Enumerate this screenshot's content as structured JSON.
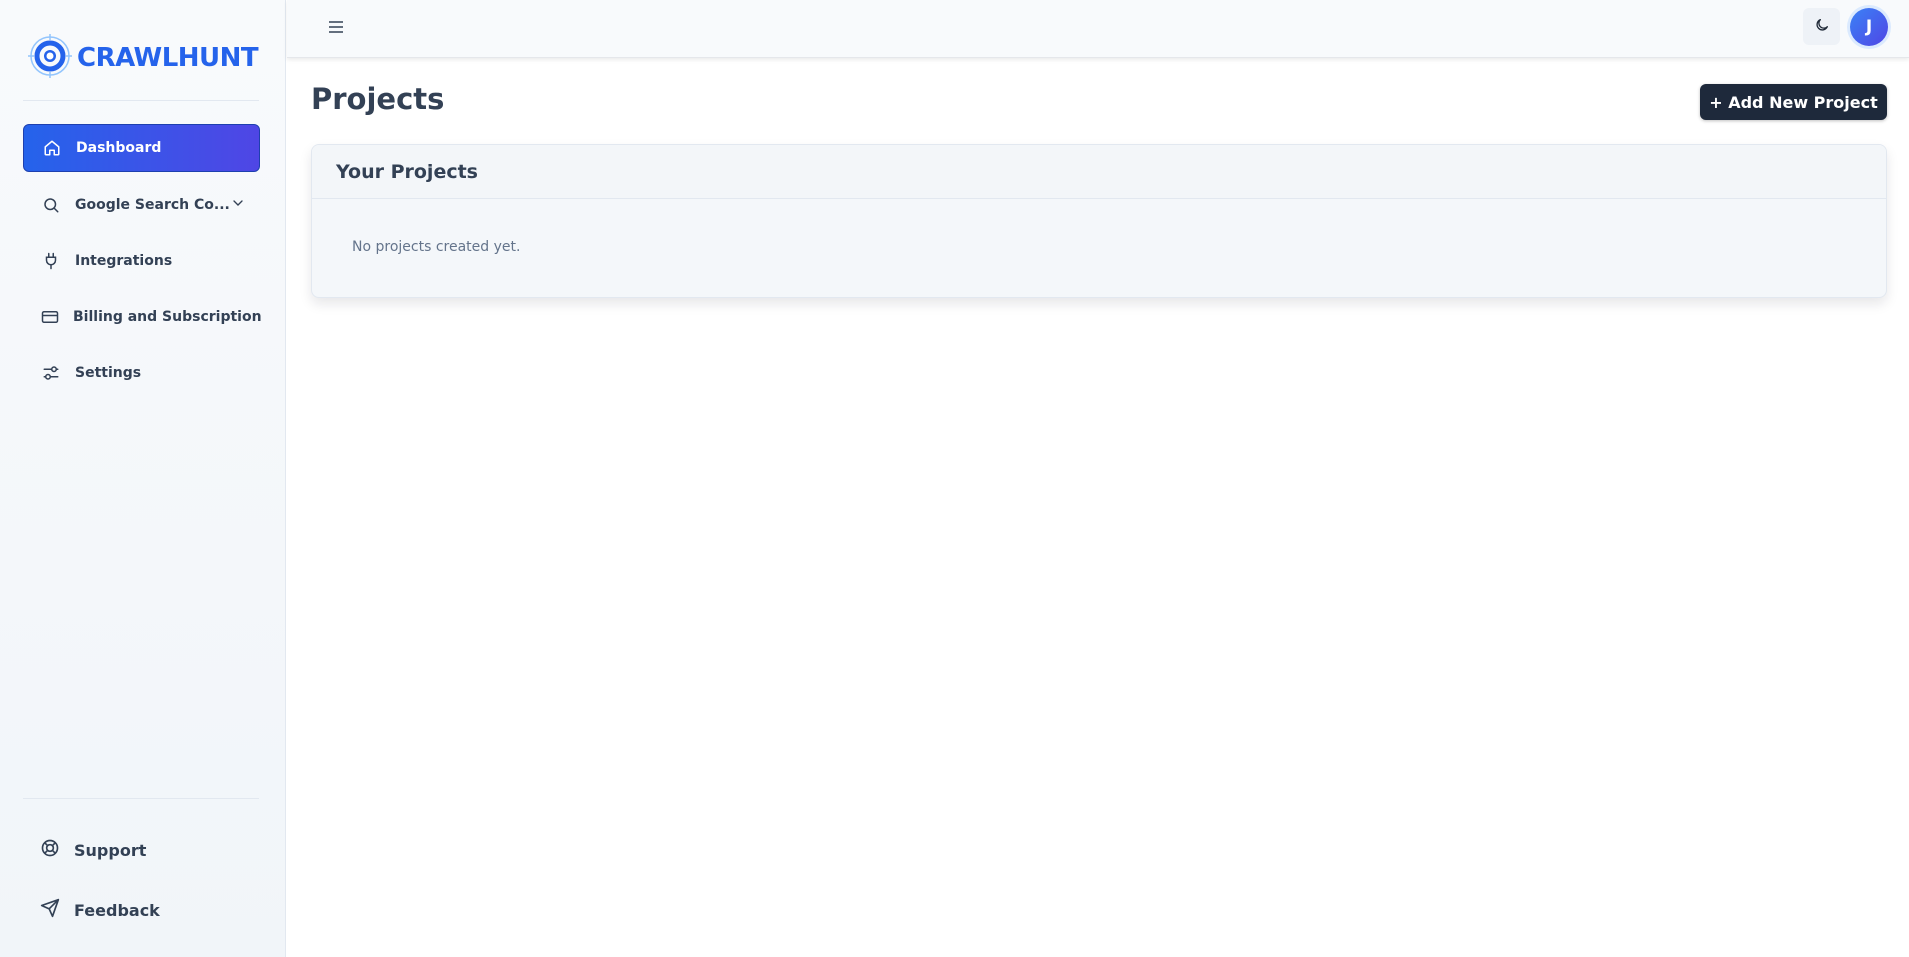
{
  "brand": {
    "name": "CRAWLHUNT",
    "color": "#2563eb"
  },
  "sidebar": {
    "items": [
      {
        "label": "Dashboard",
        "icon": "home-icon",
        "active": true
      },
      {
        "label": "Google Search Co...",
        "icon": "search-icon",
        "expandable": true
      },
      {
        "label": "Integrations",
        "icon": "plug-icon"
      },
      {
        "label": "Billing and Subscription",
        "icon": "credit-card-icon"
      },
      {
        "label": "Settings",
        "icon": "sliders-icon"
      }
    ],
    "bottom": [
      {
        "label": "Support",
        "icon": "lifebuoy-icon"
      },
      {
        "label": "Feedback",
        "icon": "send-icon"
      }
    ]
  },
  "topbar": {
    "avatar_initial": "J",
    "theme_icon": "moon-icon",
    "menu_icon": "hamburger-icon"
  },
  "main": {
    "title": "Projects",
    "add_button": "+ Add New Project",
    "card": {
      "title": "Your Projects",
      "empty_text": "No projects created yet."
    }
  },
  "colors": {
    "accent": "#2563eb",
    "accent_end": "#4f46e5",
    "button_dark": "#1e293b"
  }
}
